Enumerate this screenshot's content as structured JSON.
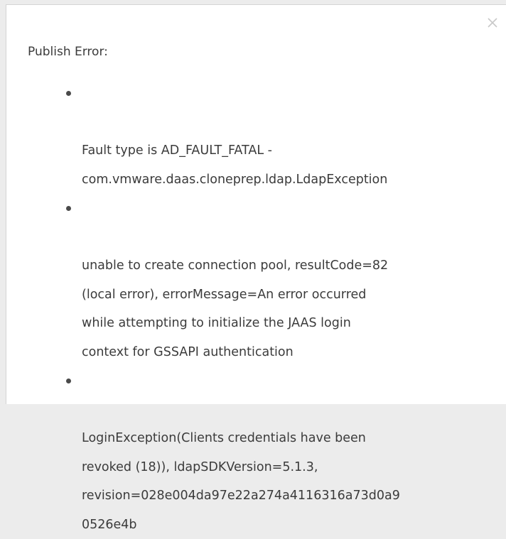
{
  "dialog": {
    "close_icon": "close-icon",
    "title": "Publish Error:",
    "errors": [
      {
        "text": "Fault type is AD_FAULT_FATAL -\ncom.vmware.daas.cloneprep.ldap.LdapException"
      },
      {
        "text": "unable to create connection pool, resultCode=82\n(local error), errorMessage=An error occurred\nwhile attempting to initialize the JAAS login\ncontext for GSSAPI authentication"
      },
      {
        "text": "LoginException(Clients credentials have been\nrevoked (18)), ldapSDKVersion=5.1.3,\nrevision=028e004da97e22a274a4116316a73d0a9\n0526e4b"
      }
    ]
  }
}
